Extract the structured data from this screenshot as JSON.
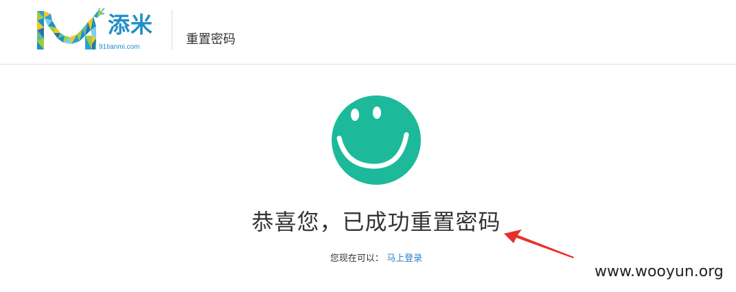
{
  "header": {
    "logo_text": "添米",
    "logo_sub": "91tianmi.com",
    "page_title": "重置密码"
  },
  "main": {
    "icon": "smiley-face-icon",
    "heading": "恭喜您，已成功重置密码",
    "next_prompt": "您现在可以：",
    "login_link": "马上登录"
  },
  "annotation": {
    "watermark": "www.wooyun.org"
  },
  "colors": {
    "brand_blue": "#1f8ec9",
    "smiley_green": "#1cba9b",
    "link_blue": "#2c7fc2",
    "arrow_red": "#e8302a"
  }
}
